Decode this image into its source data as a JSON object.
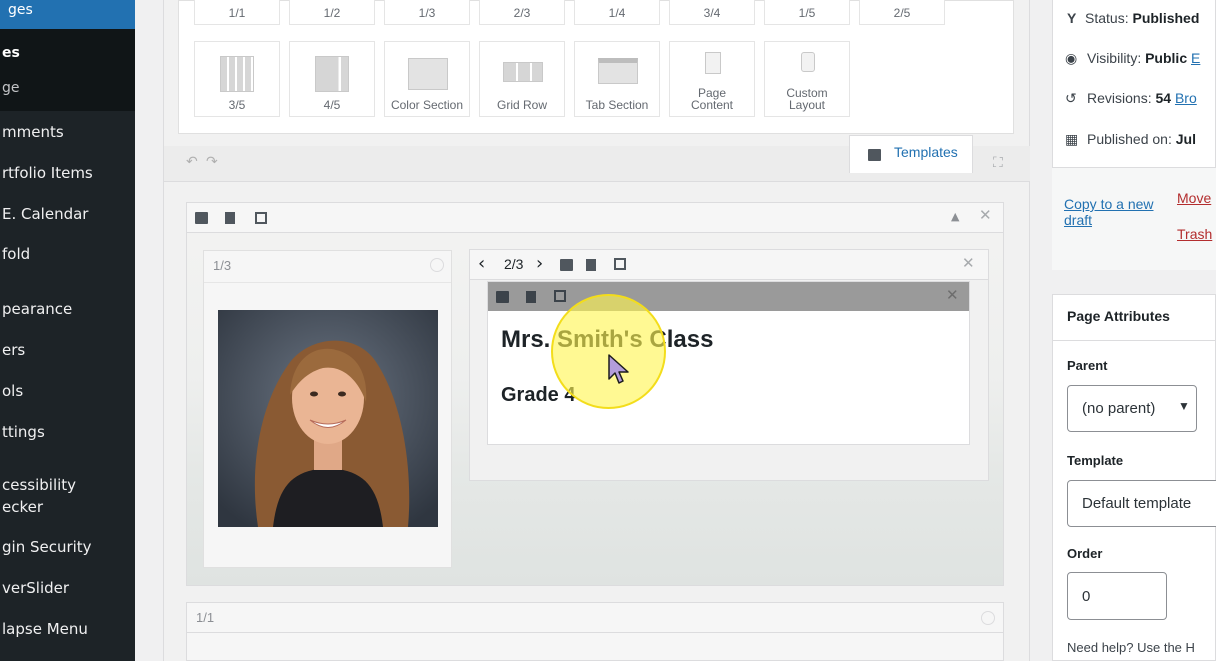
{
  "sidebar": {
    "active_label": "ges",
    "sub_items": [
      "es",
      "ge"
    ],
    "items": [
      "mments",
      "rtfolio Items",
      "E. Calendar",
      "fold",
      "pearance",
      "ers",
      "ols",
      "ttings",
      "cessibility",
      "ecker",
      "gin Security",
      "verSlider",
      "lapse Menu"
    ]
  },
  "elements": {
    "top_row": [
      "1/1",
      "1/2",
      "1/3",
      "2/3",
      "1/4",
      "3/4",
      "1/5",
      "2/5"
    ],
    "bottom_row": [
      "3/5",
      "4/5",
      "Color Section",
      "Grid Row",
      "Tab Section"
    ],
    "page_content": [
      "Page",
      "Content"
    ],
    "custom_layout": [
      "Custom",
      "Layout"
    ]
  },
  "toolbar": {
    "undo_icon": "undo-icon",
    "redo_icon": "redo-icon",
    "templates_label": "Templates",
    "fullscreen_icon": "fullscreen-icon"
  },
  "builder": {
    "column_left_size": "1/3",
    "column_right_size": "2/3",
    "heading": "Mrs. Smith's Class",
    "subheading": "Grade 4",
    "section2_size": "1/1"
  },
  "publish": {
    "status_label": "Status:",
    "status_value": "Published",
    "visibility_label": "Visibility:",
    "visibility_value": "Public",
    "visibility_link": "E",
    "revisions_label": "Revisions:",
    "revisions_value": "54",
    "revisions_link": "Bro",
    "published_label": "Published on:",
    "published_value": "Jul",
    "copy_line1": "Copy to a new",
    "copy_line2": "draft",
    "move": "Move",
    "trash": "Trash"
  },
  "attributes": {
    "title": "Page Attributes",
    "parent_label": "Parent",
    "parent_value": "(no parent)",
    "template_label": "Template",
    "template_value": "Default template",
    "order_label": "Order",
    "order_value": "0",
    "help": "Need help? Use the H"
  }
}
